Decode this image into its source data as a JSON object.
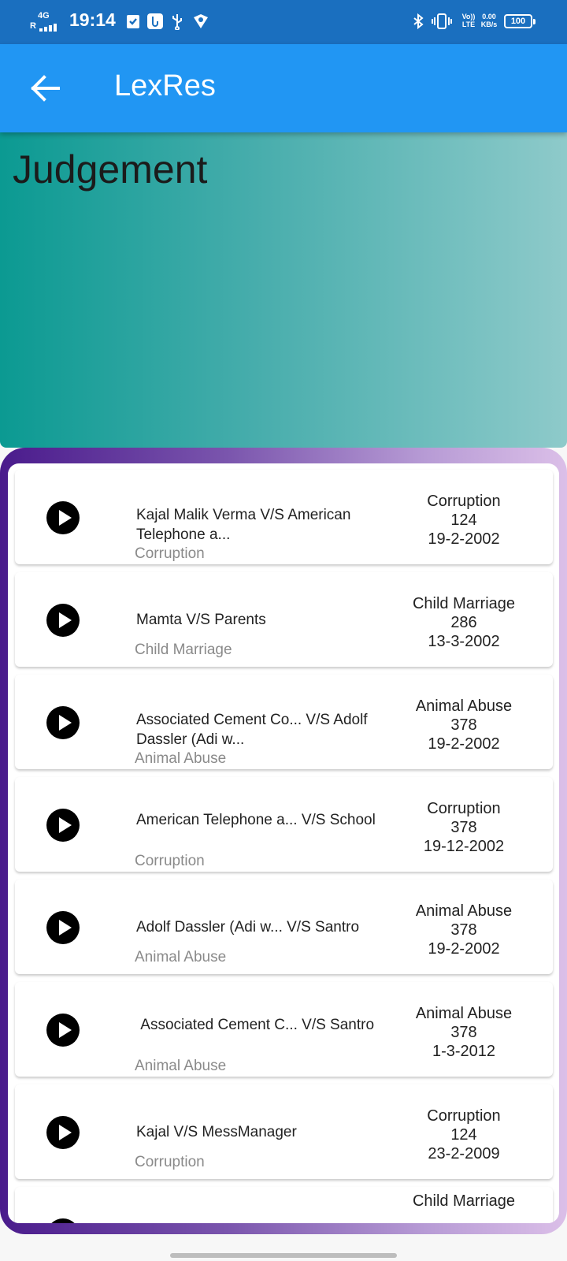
{
  "status_bar": {
    "network_type": "4G",
    "roaming": "R",
    "time": "19:14",
    "volte_top": "Vo))",
    "volte_bottom": "LTE",
    "speed_top": "0.00",
    "speed_bottom": "KB/s",
    "battery": "100"
  },
  "app_bar": {
    "title": "LexRes"
  },
  "banner": {
    "title": "Judgement"
  },
  "cases": [
    {
      "title": "Kajal Malik Verma V/S American Telephone a...",
      "category": "Corruption",
      "meta_category": "Corruption",
      "number": "124",
      "date": "19-2-2002"
    },
    {
      "title": "Mamta V/S Parents",
      "category": "Child Marriage",
      "meta_category": "Child Marriage",
      "number": "286",
      "date": "13-3-2002"
    },
    {
      "title": "Associated Cement Co... V/S Adolf Dassler (Adi w...",
      "category": "Animal Abuse",
      "meta_category": "Animal Abuse",
      "number": "378",
      "date": "19-2-2002"
    },
    {
      "title": "American Telephone a... V/S School",
      "category": "Corruption",
      "meta_category": "Corruption",
      "number": "378",
      "date": "19-12-2002"
    },
    {
      "title": "Adolf Dassler (Adi w... V/S Santro",
      "category": "Animal Abuse",
      "meta_category": "Animal Abuse",
      "number": "378",
      "date": "19-2-2002"
    },
    {
      "title": " Associated Cement C... V/S Santro",
      "category": "Animal Abuse",
      "meta_category": "Animal Abuse",
      "number": "378",
      "date": "1-3-2012"
    },
    {
      "title": "Kajal V/S MessManager",
      "category": "Corruption",
      "meta_category": "Corruption",
      "number": "124",
      "date": "23-2-2009"
    },
    {
      "title": "",
      "category": "",
      "meta_category": "Child Marriage",
      "number": "",
      "date": ""
    }
  ]
}
